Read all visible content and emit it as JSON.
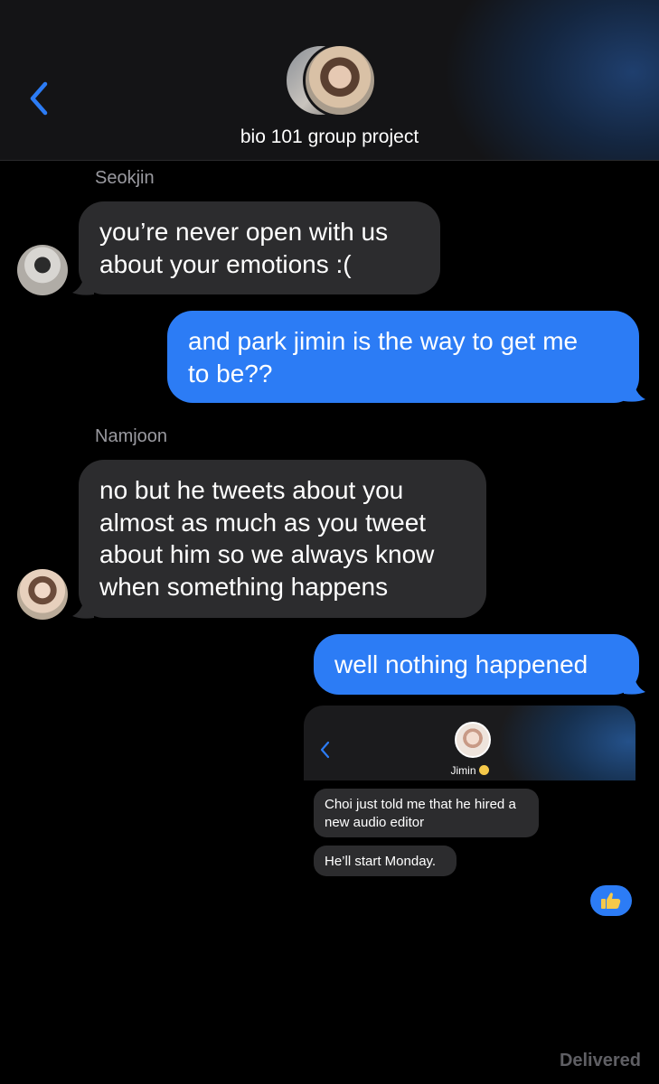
{
  "header": {
    "group_name": "bio 101 group project",
    "back_icon": "chevron-left-icon",
    "accent_color": "#2c7cf5"
  },
  "messages": [
    {
      "id": 1,
      "direction": "incoming",
      "sender": "Seokjin",
      "lines": [
        "you’re never open with us",
        "about your emotions :("
      ]
    },
    {
      "id": 2,
      "direction": "outgoing",
      "lines": [
        "and park jimin is the way to get me",
        "to be??"
      ]
    },
    {
      "id": 3,
      "direction": "incoming",
      "sender": "Namjoon",
      "lines": [
        "no but he tweets about you",
        "almost as much as you tweet",
        "about him so we always know",
        "when something happens"
      ]
    },
    {
      "id": 4,
      "direction": "outgoing",
      "lines": [
        "well nothing happened"
      ]
    }
  ],
  "embedded_screenshot": {
    "contact_name": "Jimin",
    "contact_emoji": "face-emoji",
    "messages": [
      {
        "lines": [
          "Choi just told me that he hired a",
          "new audio editor"
        ]
      },
      {
        "lines": [
          "He’ll start Monday."
        ]
      }
    ],
    "reaction_emoji": "thumbs-up-emoji"
  },
  "status": "Delivered",
  "colors": {
    "incoming_bubble": "#2c2c2e",
    "outgoing_bubble": "#2c7cf5",
    "background": "#000000"
  }
}
